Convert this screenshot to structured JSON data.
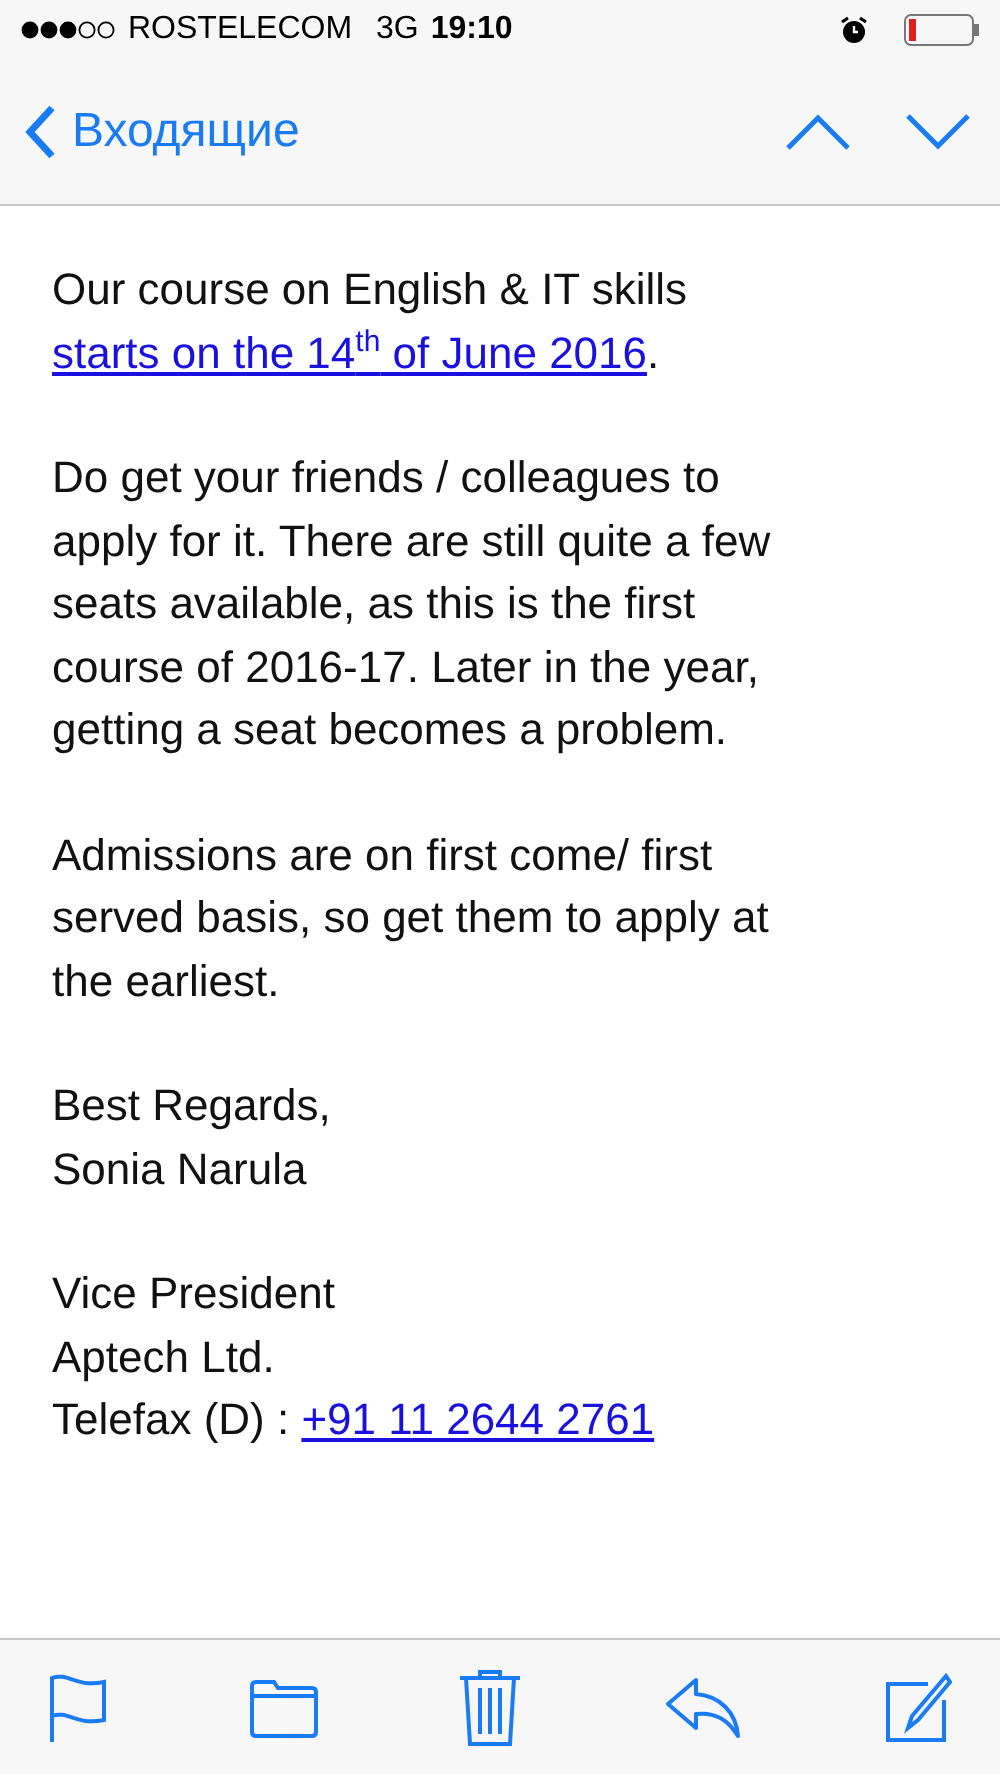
{
  "status_bar": {
    "carrier": "ROSTELECOM",
    "network": "3G",
    "time": "19:10"
  },
  "nav_bar": {
    "back_label": "Входящие"
  },
  "message": {
    "paragraphs": [
      {
        "lines": [
          [
            {
              "kind": "text",
              "text": "Our course on English & IT skills"
            }
          ],
          [
            {
              "kind": "link",
              "text": "starts on the 14$^{th}$ of June 2016"
            },
            {
              "kind": "text",
              "text": "."
            }
          ]
        ]
      },
      {
        "lines": [
          [
            {
              "kind": "text",
              "text": "Do get your friends / colleagues to"
            }
          ],
          [
            {
              "kind": "text",
              "text": "apply for it. There are still quite a few"
            }
          ],
          [
            {
              "kind": "text",
              "text": "seats available, as this is the first"
            }
          ],
          [
            {
              "kind": "text",
              "text": "course of 2016-17. Later in the year,"
            }
          ],
          [
            {
              "kind": "text",
              "text": "getting a seat becomes a problem."
            }
          ]
        ]
      },
      {
        "lines": [
          [
            {
              "kind": "text",
              "text": "Admissions are on first come/ first"
            }
          ],
          [
            {
              "kind": "text",
              "text": "served basis, so get them to apply at"
            }
          ],
          [
            {
              "kind": "text",
              "text": "the earliest."
            }
          ]
        ]
      },
      {
        "lines": [
          [
            {
              "kind": "text",
              "text": "Best Regards,"
            }
          ],
          [
            {
              "kind": "text",
              "text": "Sonia Narula"
            }
          ]
        ]
      },
      {
        "lines": [
          [
            {
              "kind": "text",
              "text": "Vice President"
            }
          ],
          [
            {
              "kind": "text",
              "text": "Aptech Ltd."
            }
          ],
          [
            {
              "kind": "text",
              "text": "Telefax (D) : "
            },
            {
              "kind": "link",
              "text": "+91 11 2644 2761"
            }
          ]
        ]
      }
    ]
  }
}
